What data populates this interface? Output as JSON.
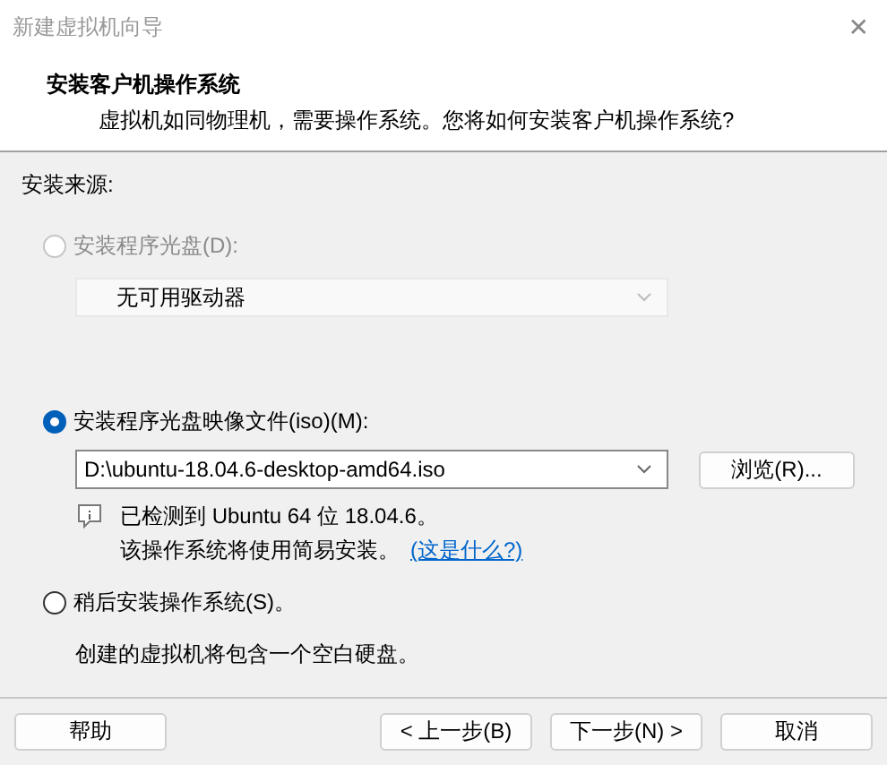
{
  "window": {
    "title": "新建虚拟机向导",
    "close": "✕"
  },
  "header": {
    "title": "安装客户机操作系统",
    "subtitle": "虚拟机如同物理机，需要操作系统。您将如何安装客户机操作系统?"
  },
  "source_label": "安装来源:",
  "options": [
    {
      "kind": "disc",
      "label": "安装程序光盘(D):",
      "selected": false,
      "disabled": true,
      "dropdown": {
        "value": "无可用驱动器",
        "disabled": true
      }
    },
    {
      "kind": "iso",
      "label": "安装程序光盘映像文件(iso)(M):",
      "selected": true,
      "disabled": false,
      "dropdown": {
        "value": "D:\\ubuntu-18.04.6-desktop-amd64.iso",
        "disabled": false
      },
      "browse": "浏览(R)...",
      "detected": "已检测到 Ubuntu 64 位 18.04.6。",
      "note": "该操作系统将使用简易安装。",
      "link": "(这是什么?)"
    },
    {
      "kind": "later",
      "label": "稍后安装操作系统(S)。",
      "selected": false,
      "disabled": false,
      "note": "创建的虚拟机将包含一个空白硬盘。"
    }
  ],
  "buttons": [
    {
      "label": "帮助",
      "disabled": false
    },
    {
      "label": "< 上一步(B)",
      "disabled": false
    },
    {
      "label": "下一步(N) >",
      "disabled": false
    },
    {
      "label": "取消",
      "disabled": false
    }
  ]
}
